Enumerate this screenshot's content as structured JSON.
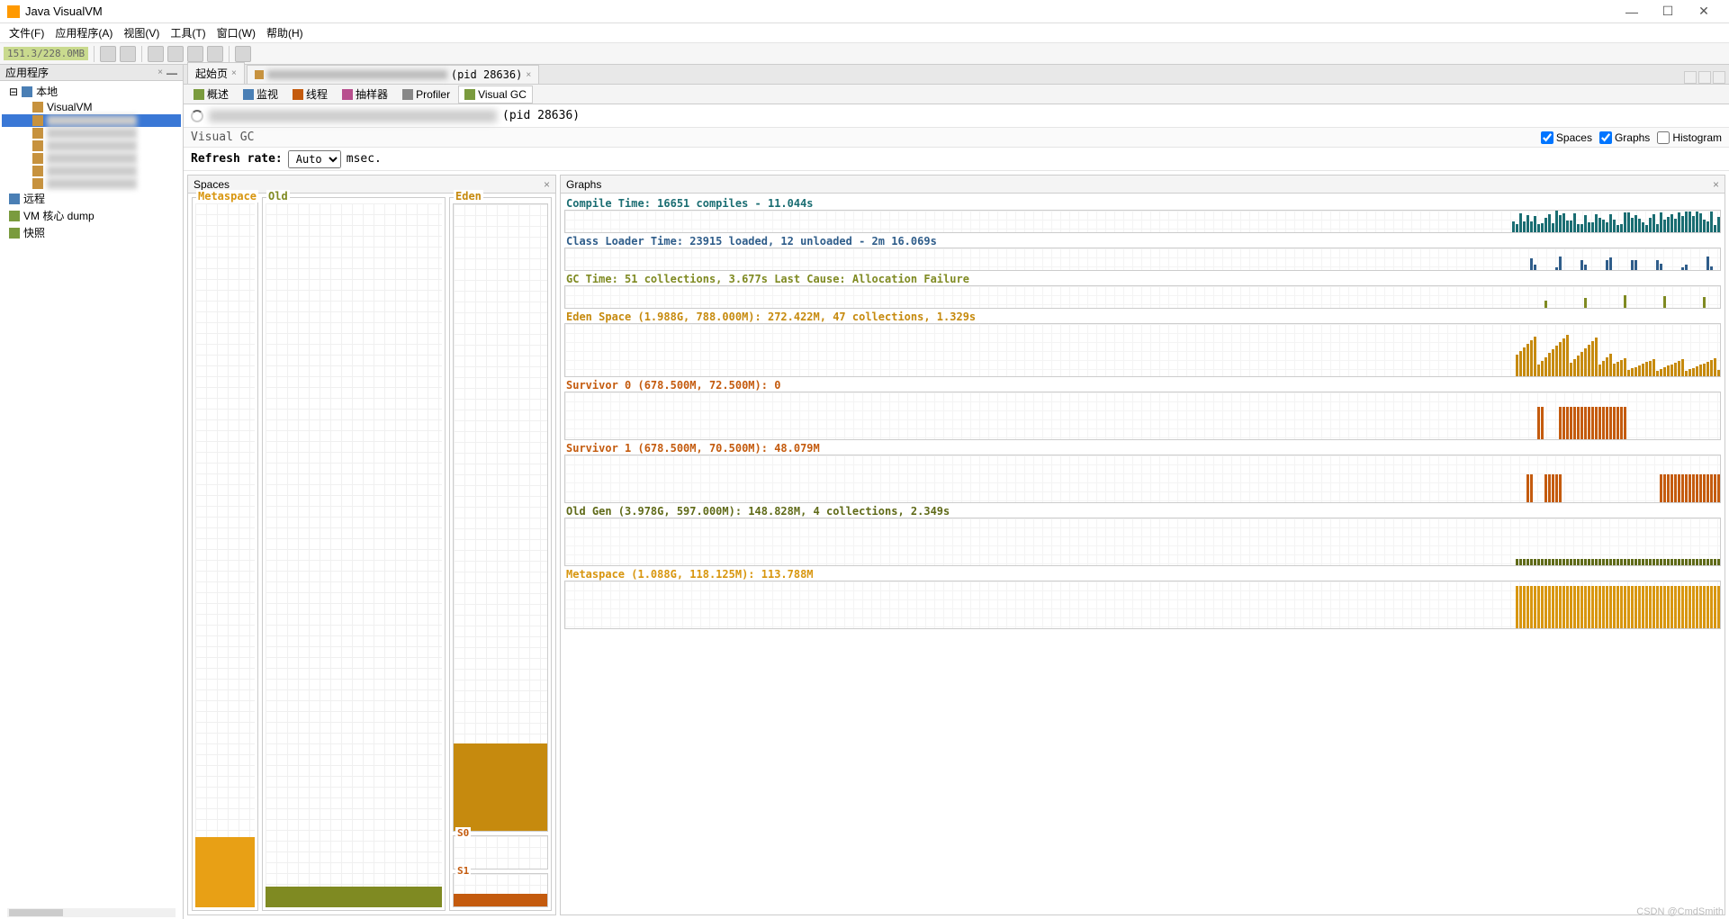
{
  "window": {
    "title": "Java VisualVM"
  },
  "menu": {
    "file": "文件(F)",
    "apps": "应用程序(A)",
    "view": "视图(V)",
    "tools": "工具(T)",
    "window": "窗口(W)",
    "help": "帮助(H)"
  },
  "toolbar": {
    "mem": "151.3/228.0MB"
  },
  "sidebar": {
    "tab": "应用程序",
    "local": "本地",
    "visualvm": "VisualVM",
    "remote": "远程",
    "vmcore": "VM 核心 dump",
    "snapshot": "快照"
  },
  "doctabs": {
    "start": "起始页",
    "pid": "(pid 28636)"
  },
  "subtabs": {
    "overview": "概述",
    "monitor": "监视",
    "threads": "线程",
    "sampler": "抽样器",
    "profiler": "Profiler",
    "visualgc": "Visual GC"
  },
  "pidrow": {
    "pid": "(pid 28636)"
  },
  "vgc": {
    "title": "Visual GC",
    "spaces": "Spaces",
    "graphs": "Graphs",
    "histogram": "Histogram"
  },
  "refresh": {
    "label": "Refresh rate:",
    "value": "Auto",
    "unit": "msec."
  },
  "spaces": {
    "title": "Spaces",
    "metaspace": "Metaspace",
    "old": "Old",
    "eden": "Eden",
    "s0": "S0",
    "s1": "S1"
  },
  "graphs": {
    "title": "Graphs",
    "compile": "Compile Time: 16651 compiles - 11.044s",
    "classloader": "Class Loader Time: 23915 loaded, 12 unloaded - 2m 16.069s",
    "gctime": "GC Time: 51 collections, 3.677s  Last Cause: Allocation Failure",
    "eden": "Eden Space (1.988G, 788.000M): 272.422M, 47 collections, 1.329s",
    "s0": "Survivor 0 (678.500M, 72.500M): 0",
    "s1": "Survivor 1 (678.500M, 70.500M): 48.079M",
    "oldgen": "Old Gen (3.978G, 597.000M): 148.828M, 4 collections, 2.349s",
    "metaspace": "Metaspace (1.088G, 118.125M): 113.788M"
  },
  "watermark": "CSDN @CmdSmith",
  "chart_data": {
    "type": "area",
    "sections": [
      {
        "name": "Compile Time",
        "compiles": 16651,
        "seconds": 11.044,
        "color": "#1a6d72"
      },
      {
        "name": "Class Loader Time",
        "loaded": 23915,
        "unloaded": 12,
        "duration": "2m 16.069s",
        "color": "#2f5d8a"
      },
      {
        "name": "GC Time",
        "collections": 51,
        "seconds": 3.677,
        "last_cause": "Allocation Failure",
        "color": "#7f8a22"
      },
      {
        "name": "Eden Space",
        "max": "1.988G",
        "capacity": "788.000M",
        "used": "272.422M",
        "collections": 47,
        "seconds": 1.329,
        "color": "#c68a0e"
      },
      {
        "name": "Survivor 0",
        "max": "678.500M",
        "capacity": "72.500M",
        "used": 0,
        "color": "#c45b0e"
      },
      {
        "name": "Survivor 1",
        "max": "678.500M",
        "capacity": "70.500M",
        "used": "48.079M",
        "color": "#c45b0e"
      },
      {
        "name": "Old Gen",
        "max": "3.978G",
        "capacity": "597.000M",
        "used": "148.828M",
        "collections": 4,
        "seconds": 2.349,
        "color": "#5f6a18"
      },
      {
        "name": "Metaspace",
        "max": "1.088G",
        "capacity": "118.125M",
        "used": "113.788M",
        "color": "#d8960f"
      }
    ]
  }
}
